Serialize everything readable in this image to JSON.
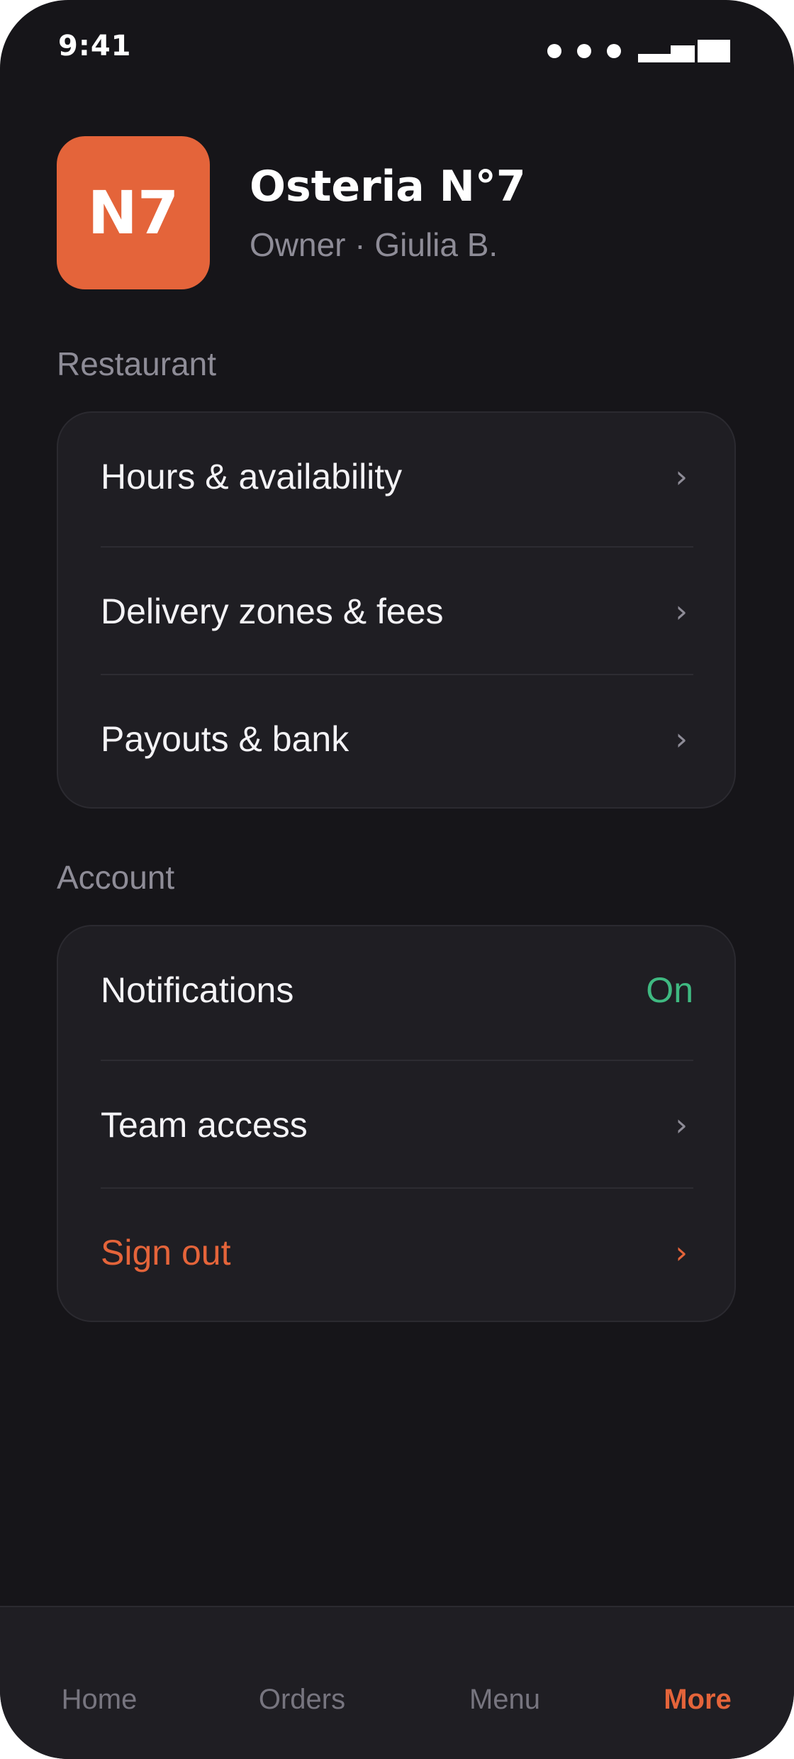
{
  "status_bar": {
    "time": "9:41"
  },
  "header": {
    "logo_initials": "N7",
    "restaurant_name": "Osteria N°7",
    "subtitle": "Owner · Giulia B."
  },
  "sections": {
    "restaurant": {
      "title": "Restaurant",
      "items": [
        {
          "label": "Hours & availability",
          "icon": "chevron-right-icon"
        },
        {
          "label": "Delivery zones & fees",
          "icon": "chevron-right-icon"
        },
        {
          "label": "Payouts & bank",
          "icon": "chevron-right-icon"
        }
      ]
    },
    "account": {
      "title": "Account",
      "items": [
        {
          "label": "Notifications",
          "value": "On"
        },
        {
          "label": "Team access",
          "icon": "chevron-right-icon"
        },
        {
          "label": "Sign out",
          "icon": "chevron-right-icon"
        }
      ]
    }
  },
  "chevron_glyph": "›",
  "tabbar": {
    "tabs": [
      {
        "label": "Home",
        "active": false
      },
      {
        "label": "Orders",
        "active": false
      },
      {
        "label": "Menu",
        "active": false
      },
      {
        "label": "More",
        "active": true
      }
    ]
  },
  "colors": {
    "background": "#161519",
    "card": "#1f1e23",
    "accent": "#e4643a",
    "on_status": "#3fb981",
    "muted_text": "#8e8c97"
  }
}
